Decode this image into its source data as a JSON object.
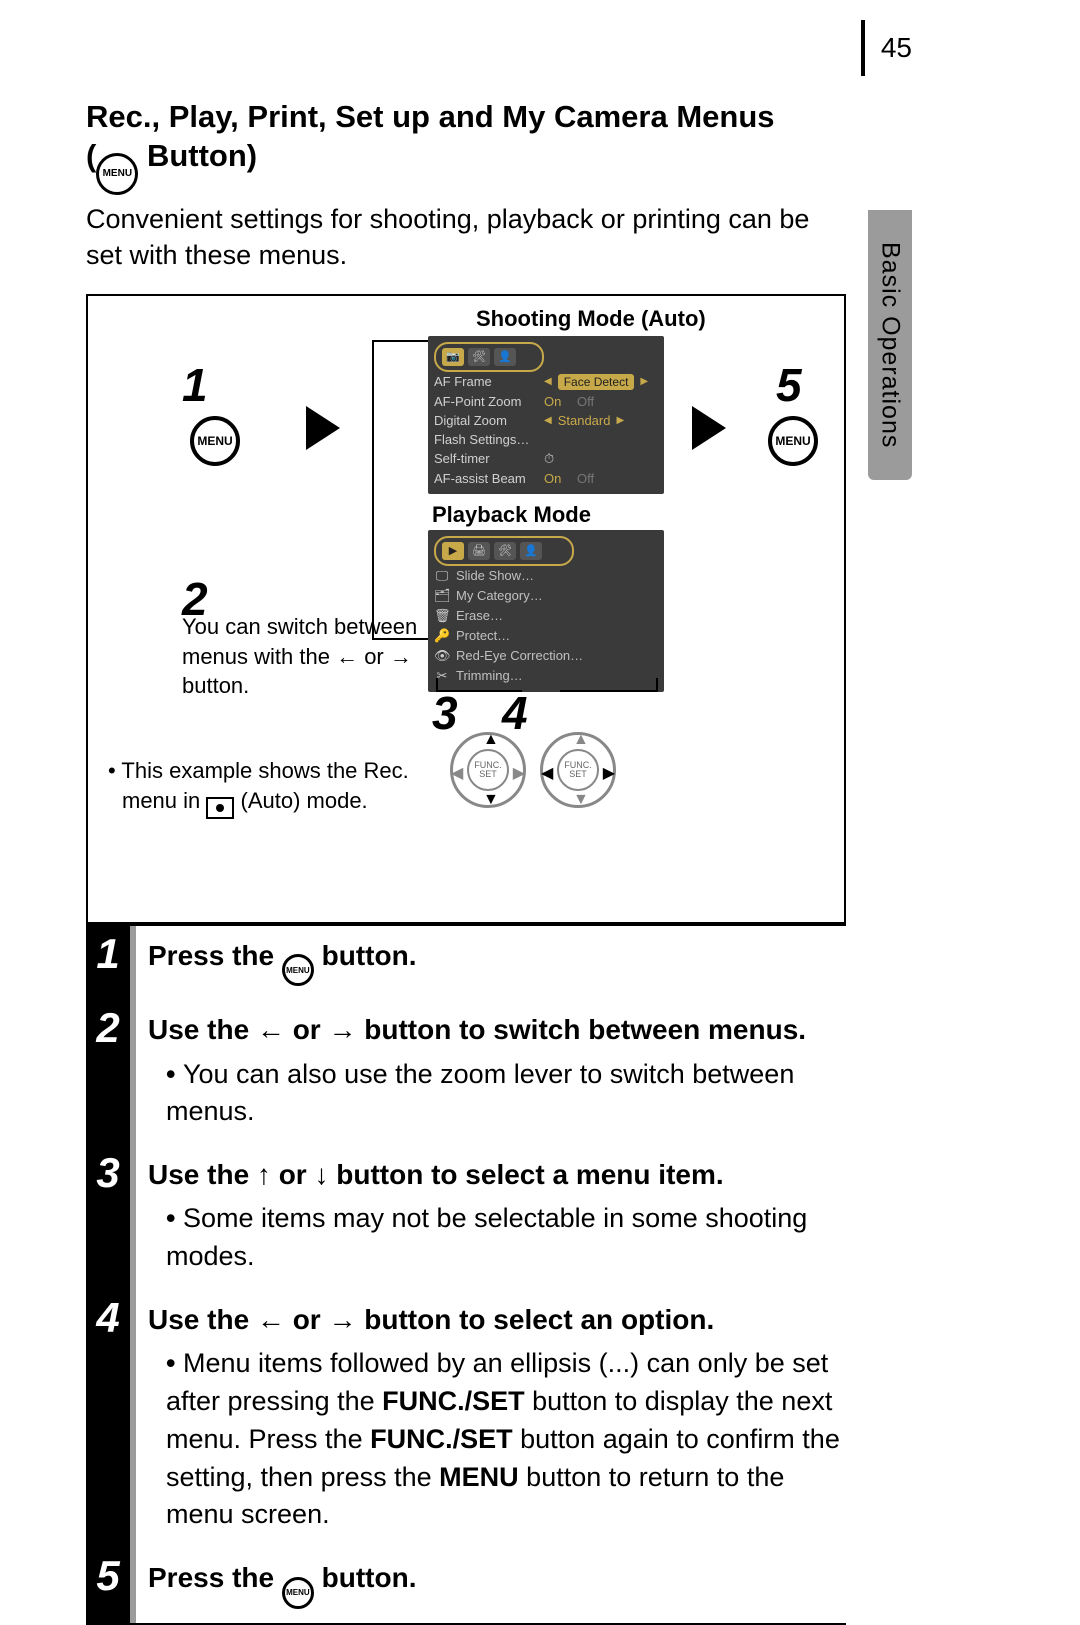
{
  "page_number": "45",
  "side_tab": "Basic Operations",
  "title_line1": "Rec., Play, Print, Set up and My Camera Menus",
  "title_prefix": "(",
  "menu_icon_label": "MENU",
  "title_suffix": " Button)",
  "intro": "Convenient settings for shooting, playback or printing can be set with these menus.",
  "diagram": {
    "shoot_label": "Shooting Mode (Auto)",
    "play_label": "Playback Mode",
    "n1": "1",
    "n2": "2",
    "n3": "3",
    "n4": "4",
    "n5": "5",
    "switch_note_1": "You can switch between",
    "switch_note_2_a": "menus with the ",
    "switch_note_2_b": " or ",
    "switch_note_3": "button.",
    "example_1": "This example shows the Rec.",
    "example_2_a": "menu in ",
    "example_2_b": " (Auto) mode.",
    "func_label_1": "FUNC.",
    "func_label_2": "SET"
  },
  "shoot_menu": {
    "r1": "AF Frame",
    "v1": "Face Detect",
    "r2": "AF-Point Zoom",
    "v2a": "On",
    "v2b": "Off",
    "r3": "Digital Zoom",
    "v3": "Standard",
    "r4": "Flash Settings…",
    "r5": "Self-timer",
    "r6": "AF-assist Beam",
    "v6a": "On",
    "v6b": "Off"
  },
  "play_menu": {
    "r1": "Slide Show…",
    "r2": "My Category…",
    "r3": "Erase…",
    "r4": "Protect…",
    "r5": "Red-Eye Correction…",
    "r6": "Trimming…"
  },
  "steps": [
    {
      "num": "1",
      "title_a": "Press the ",
      "title_b": " button."
    },
    {
      "num": "2",
      "title": "Use the ← or → button to switch between menus.",
      "bullets": [
        "You can also use the zoom lever to switch between menus."
      ]
    },
    {
      "num": "3",
      "title": "Use the ↑ or ↓ button to select a menu item.",
      "bullets": [
        "Some items may not be selectable in some shooting modes."
      ]
    },
    {
      "num": "4",
      "title": "Use the ← or → button to select an option.",
      "bullets_rich": {
        "a": "Menu items followed by an ellipsis (...) can only be set after pressing the ",
        "b": "FUNC./SET",
        "c": " button to display the next menu. Press the ",
        "d": "FUNC./SET",
        "e": " button again to confirm the setting, then press the ",
        "f": "MENU",
        "g": " button to return to the menu screen."
      }
    },
    {
      "num": "5",
      "title_a": "Press the ",
      "title_b": " button."
    }
  ]
}
